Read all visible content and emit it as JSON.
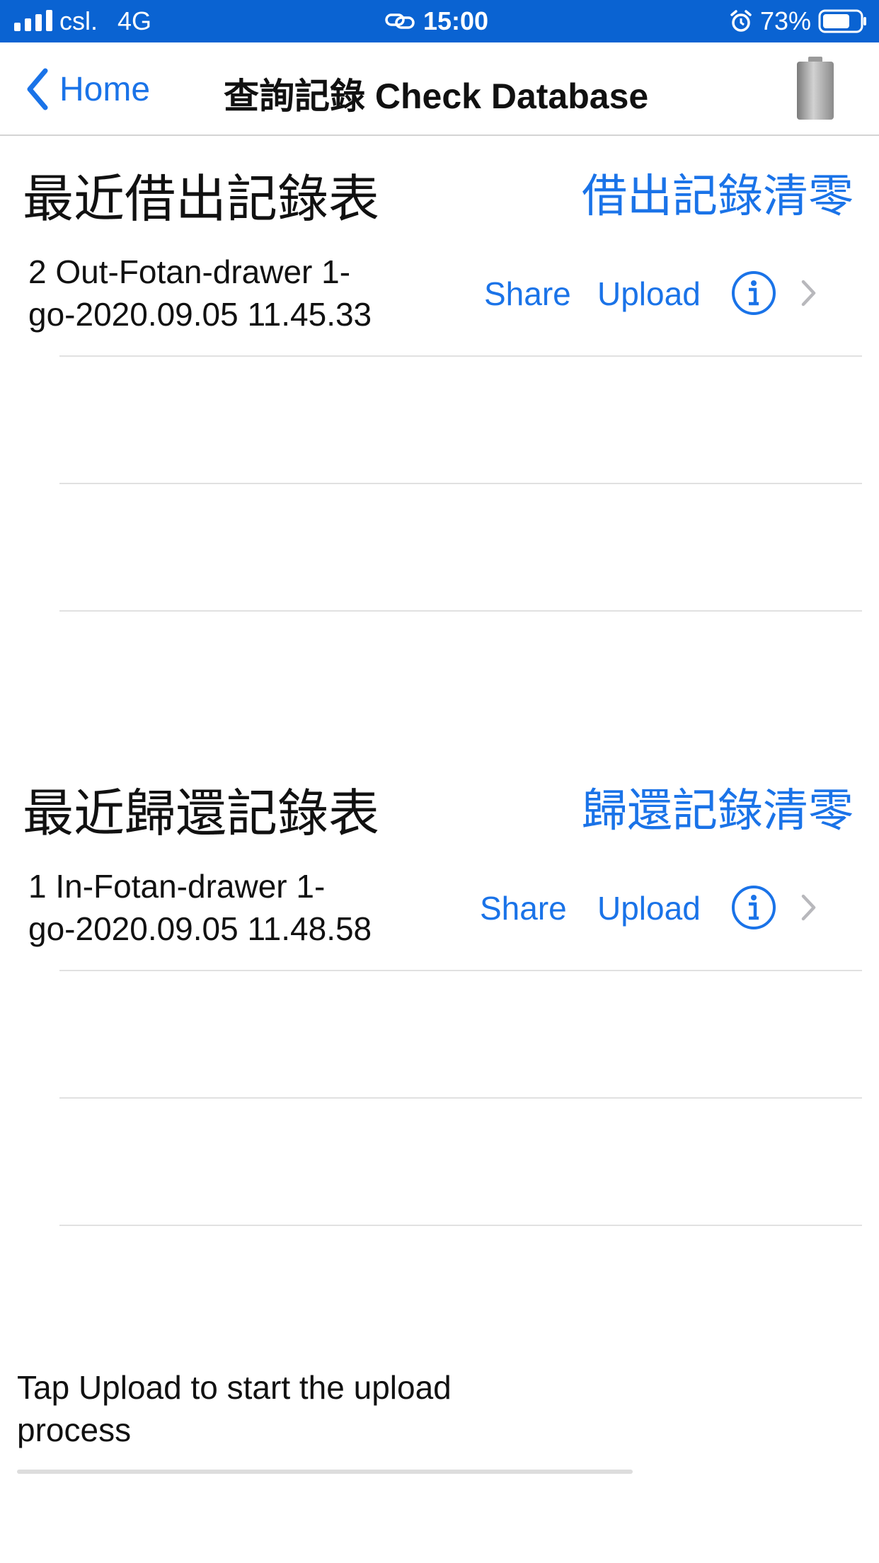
{
  "status_bar": {
    "carrier": "csl.",
    "network": "4G",
    "time": "15:00",
    "battery_percent": "73%",
    "battery_level": 0.73
  },
  "nav": {
    "back_label": "Home",
    "title": "查詢記錄 Check Database"
  },
  "borrow_section": {
    "title": "最近借出記錄表",
    "clear_label": "借出記錄清零",
    "record": {
      "line1": "2 Out-Fotan-drawer 1-",
      "line2": "go-2020.09.05 11.45.33",
      "share_label": "Share",
      "upload_label": "Upload"
    }
  },
  "return_section": {
    "title": "最近歸還記錄表",
    "clear_label": "歸還記錄清零",
    "record": {
      "line1": "1 In-Fotan-drawer 1-",
      "line2": "go-2020.09.05 11.48.58",
      "share_label": "Share",
      "upload_label": "Upload"
    }
  },
  "footer": {
    "hint_line1": "Tap Upload to start the upload",
    "hint_line2": "process",
    "upload_progress": 0
  },
  "colors": {
    "status_bar": "#0a63d2",
    "accent": "#1a73e8",
    "separator": "#e1e1e1"
  }
}
